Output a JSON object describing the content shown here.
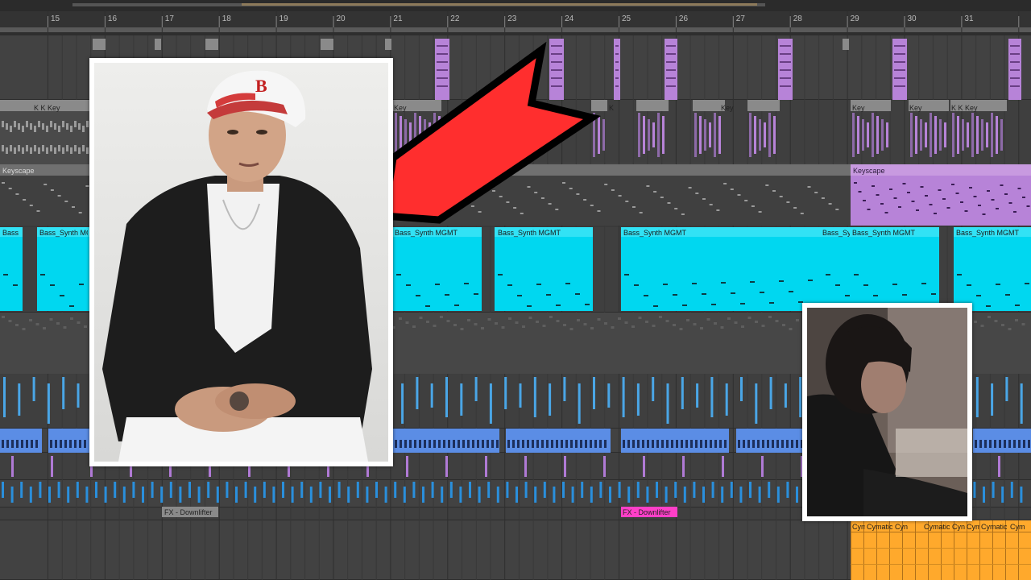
{
  "ruler": {
    "bars": [
      "15",
      "16",
      "17",
      "18",
      "19",
      "20",
      "21",
      "22",
      "23",
      "24",
      "25",
      "26",
      "27",
      "28",
      "29",
      "30",
      "31"
    ]
  },
  "tracks": {
    "keys_clips": [
      "K  K  Key",
      "Key",
      "K",
      "Key",
      "Key",
      "Key",
      "K  K Key"
    ],
    "keyscape": {
      "name": "Keyscape"
    },
    "keyscape_right": {
      "name": "Keyscape"
    },
    "bass_clips": [
      "Bass",
      "Bass_Synth MGMT",
      "Bass_Synth MGMT",
      "Bass_Synth MGMT",
      "Bass_Synth MGMT",
      "Bass_Sy",
      "Bass_Synth MGMT",
      "Bass_Synth MGMT"
    ],
    "fx_clip_1": "FX - Downlifter",
    "fx_clip_2": "FX - Downlifter",
    "cymatics_clips": [
      "Cym",
      "Cymatic",
      "Cyn",
      "Cymatic",
      "Cyn",
      "Cym",
      "Cymatic",
      "Cym"
    ]
  },
  "colors": {
    "background": "#3a3a3a",
    "track_lane": "#444444",
    "purple_clip": "#b783d8",
    "cyan_clip": "#00d7f0",
    "blue_clip": "#5b8de5",
    "pink_clip": "#ff3fc8",
    "orange_clip": "#ffa92c",
    "arrow_red": "#ff2e2e"
  }
}
